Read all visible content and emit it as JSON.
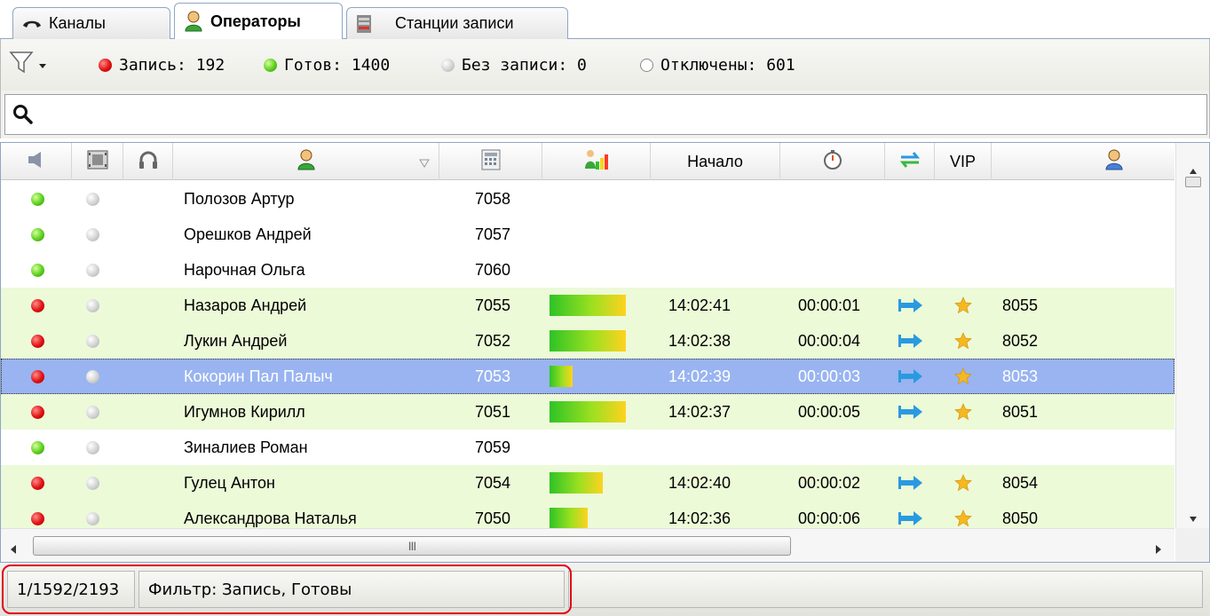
{
  "tabs": [
    {
      "label": "Каналы",
      "icon": "phone-icon"
    },
    {
      "label": "Операторы",
      "icon": "operator-icon"
    },
    {
      "label": "Станции записи",
      "icon": "server-icon"
    }
  ],
  "filters": {
    "filter_icon": "funnel-icon",
    "record": "Запись: 192",
    "ready": "Готов: 1400",
    "no_record": "Без записи: 0",
    "disabled": "Отключены: 601"
  },
  "search": {
    "placeholder": ""
  },
  "columns": {
    "col_sound": "speaker-icon",
    "col_video": "film-icon",
    "col_headset": "headphones-icon",
    "col_operator": "operator-icon",
    "col_phone": "phone-list-icon",
    "col_level": "level-icon",
    "col_start": "Начало",
    "col_duration": "stopwatch-icon",
    "col_direction": "sync-icon",
    "col_vip": "VIP",
    "col_client": "client-icon"
  },
  "rows": [
    {
      "status": "green",
      "name": "Полозов Артур",
      "ext": "7058",
      "level": 0,
      "start": "",
      "duration": "",
      "vip": false,
      "number": ""
    },
    {
      "status": "green",
      "name": "Орешков Андрей",
      "ext": "7057",
      "level": 0,
      "start": "",
      "duration": "",
      "vip": false,
      "number": ""
    },
    {
      "status": "green",
      "name": "Нарочная Ольга",
      "ext": "7060",
      "level": 0,
      "start": "",
      "duration": "",
      "vip": false,
      "number": ""
    },
    {
      "status": "red",
      "name": "Назаров Андрей",
      "ext": "7055",
      "level": 1.0,
      "start": "14:02:41",
      "duration": "00:00:01",
      "vip": true,
      "number": "8055"
    },
    {
      "status": "red",
      "name": "Лукин Андрей",
      "ext": "7052",
      "level": 1.0,
      "start": "14:02:38",
      "duration": "00:00:04",
      "vip": true,
      "number": "8052"
    },
    {
      "status": "red",
      "name": "Кокорин Пал Палыч",
      "ext": "7053",
      "level": 0.3,
      "start": "14:02:39",
      "duration": "00:00:03",
      "vip": true,
      "number": "8053"
    },
    {
      "status": "red",
      "name": "Игумнов Кирилл",
      "ext": "7051",
      "level": 1.0,
      "start": "14:02:37",
      "duration": "00:00:05",
      "vip": true,
      "number": "8051"
    },
    {
      "status": "green",
      "name": "Зиналиев Роман",
      "ext": "7059",
      "level": 0,
      "start": "",
      "duration": "",
      "vip": false,
      "number": ""
    },
    {
      "status": "red",
      "name": "Гулец Антон",
      "ext": "7054",
      "level": 0.7,
      "start": "14:02:40",
      "duration": "00:00:02",
      "vip": true,
      "number": "8054"
    },
    {
      "status": "red",
      "name": "Александрова Наталья",
      "ext": "7050",
      "level": 0.5,
      "start": "14:02:36",
      "duration": "00:00:06",
      "vip": true,
      "number": "8050"
    }
  ],
  "selected_row": 5,
  "scroll": {
    "grip": "III"
  },
  "statusbar": {
    "counts": "1/1592/2193",
    "filter": "Фильтр: Запись, Готовы"
  }
}
